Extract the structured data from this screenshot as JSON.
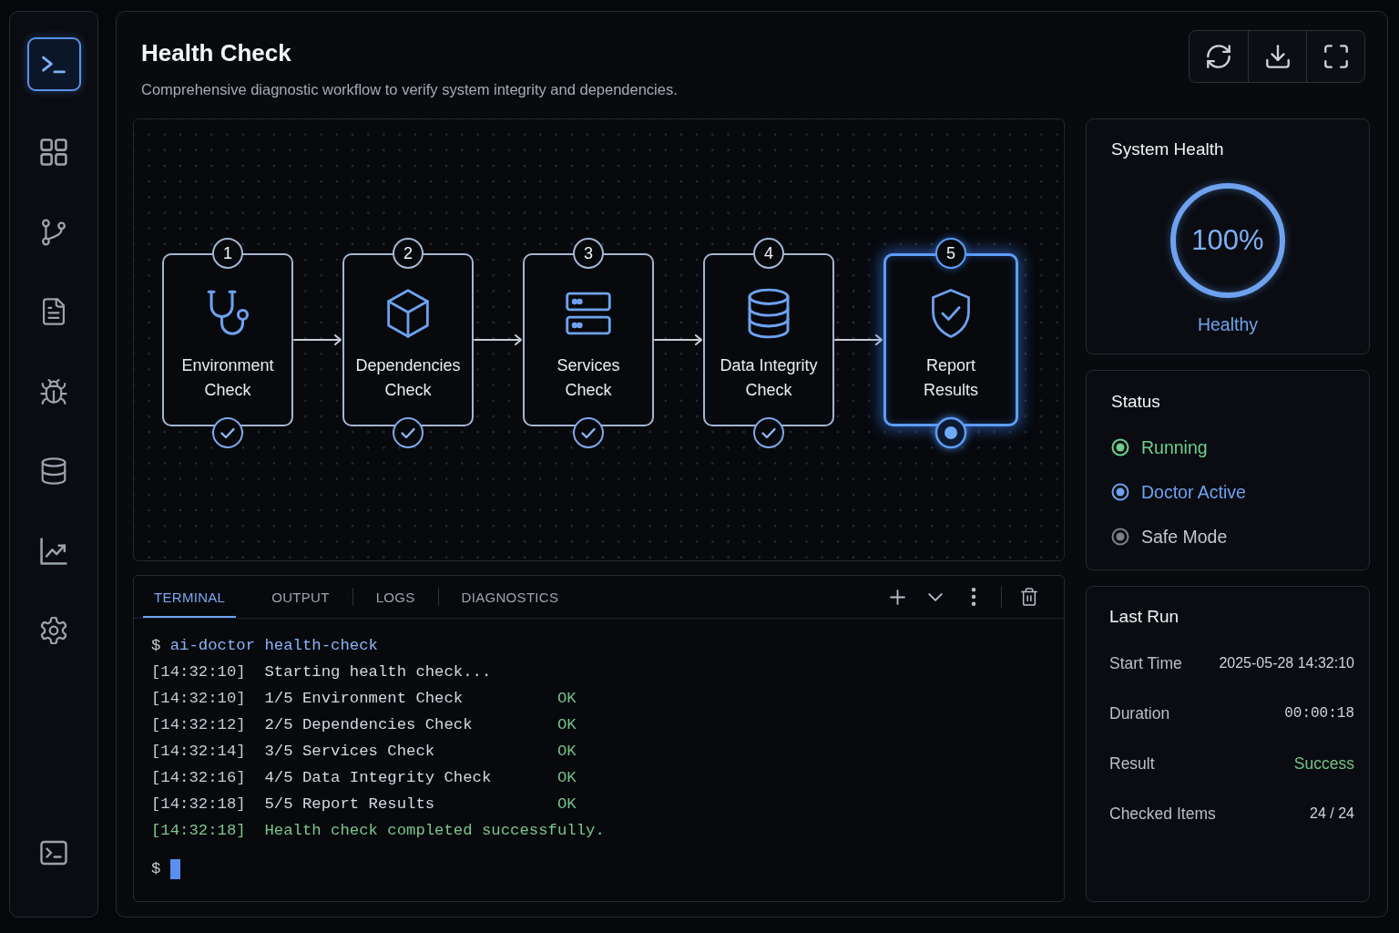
{
  "sidebar": {
    "items": [
      {
        "selected": true
      },
      {
        "selected": false
      },
      {
        "selected": false
      },
      {
        "selected": false
      },
      {
        "selected": false
      },
      {
        "selected": false
      },
      {
        "selected": false
      },
      {
        "selected": false
      }
    ],
    "footer_items": [
      {
        "selected": false
      }
    ]
  },
  "header": {
    "title": "Health Check",
    "subtitle": "Comprehensive diagnostic workflow to verify system integrity and dependencies."
  },
  "workflow": {
    "steps": [
      {
        "number": "1",
        "label": "Environment\nCheck",
        "completed": true,
        "current": false
      },
      {
        "number": "2",
        "label": "Dependencies\nCheck",
        "completed": true,
        "current": false
      },
      {
        "number": "3",
        "label": "Services\nCheck",
        "completed": true,
        "current": false
      },
      {
        "number": "4",
        "label": "Data Integrity\nCheck",
        "completed": true,
        "current": false
      },
      {
        "number": "5",
        "label": "Report\nResults",
        "completed": false,
        "current": true
      }
    ]
  },
  "system_health": {
    "title": "System Health",
    "level": 1,
    "value": "100%",
    "label": "Healthy"
  },
  "status": {
    "title": "Status",
    "items": [
      {
        "label": "Running",
        "color": "#6fcf8e",
        "active": true
      },
      {
        "label": "Doctor Active",
        "color": "#6ea2ef",
        "active": true
      },
      {
        "label": "Safe Mode",
        "color": "#7c8089",
        "active": false
      }
    ]
  },
  "terminal": {
    "tabs": [
      {
        "label": "TERMINAL",
        "selected": true
      },
      {
        "label": "OUTPUT",
        "selected": false
      },
      {
        "label": "LOGS",
        "selected": false
      },
      {
        "label": "DIAGNOSTICS",
        "selected": false
      }
    ],
    "lines": [
      {
        "kind": "command",
        "prompt": "$",
        "command": "ai-doctor health-check"
      },
      {
        "kind": "log",
        "time": "[14:32:10]",
        "message": "Starting health check..."
      },
      {
        "kind": "log",
        "time": "[14:32:10]",
        "message": "1/5 Environment Check",
        "result": "OK"
      },
      {
        "kind": "log",
        "time": "[14:32:12]",
        "message": "2/5 Dependencies Check",
        "result": "OK"
      },
      {
        "kind": "log",
        "time": "[14:32:14]",
        "message": "3/5 Services Check",
        "result": "OK"
      },
      {
        "kind": "log",
        "time": "[14:32:16]",
        "message": "4/5 Data Integrity Check",
        "result": "OK"
      },
      {
        "kind": "log",
        "time": "[14:32:18]",
        "message": "5/5 Report Results",
        "result": "OK"
      },
      {
        "kind": "success",
        "time": "[14:32:18]",
        "message": "Health check completed successfully."
      },
      {
        "kind": "input",
        "prompt": "$"
      }
    ]
  },
  "last_run": {
    "title": "Last Run",
    "rows": [
      {
        "label": "Start Time",
        "value": "2025-05-28 14:32:10",
        "kind": "text"
      },
      {
        "label": "Duration",
        "value": "00:00:18",
        "kind": "mono"
      },
      {
        "label": "Result",
        "value": "Success",
        "kind": "success"
      },
      {
        "label": "Checked Items",
        "value": "24 / 24",
        "kind": "text"
      }
    ]
  }
}
